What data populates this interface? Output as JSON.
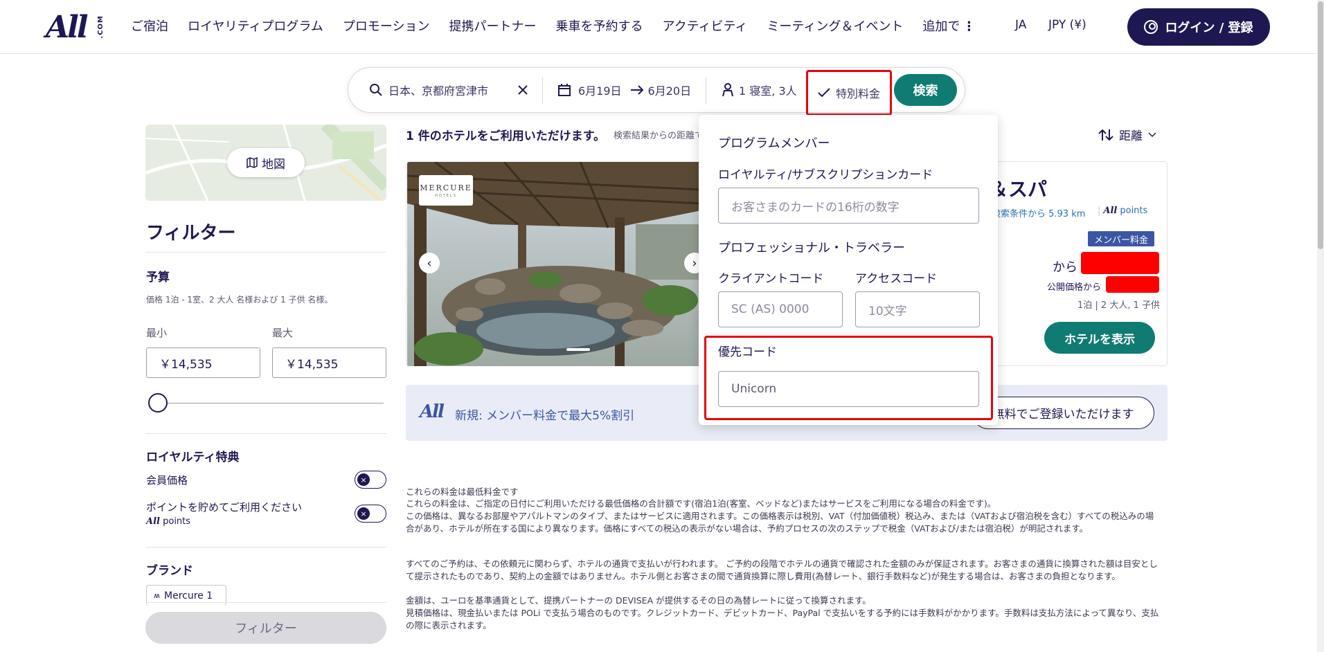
{
  "header": {
    "logo": "All",
    "logo_suffix": ".COM",
    "nav": [
      "ご宿泊",
      "ロイヤリティプログラム",
      "プロモーション",
      "提携パートナー",
      "乗車を予約する",
      "アクティビティ",
      "ミーティング＆イベント",
      "追加で"
    ],
    "language": "JA",
    "currency": "JPY (¥)",
    "login_label": "ログイン / 登録"
  },
  "search": {
    "destination": "日本、京都府宮津市",
    "checkin": "6月19日",
    "checkout": "6月20日",
    "guests": "1 寝室, 3人",
    "special_rate": "特別料金",
    "search_label": "検索"
  },
  "sidebar": {
    "map_label": "地図",
    "filter_title": "フィルター",
    "budget_title": "予算",
    "budget_sub": "価格 1泊 - 1室、2 大人 名様および 1 子供 名様。",
    "min_label": "最小",
    "max_label": "最大",
    "min_value": "￥14,535",
    "max_value": "￥14,535",
    "loyalty_title": "ロイヤルティ特典",
    "member_price_label": "会員価格",
    "points_label": "ポイントを貯めてご利用ください",
    "points_brand": "points",
    "brand_title": "ブランド",
    "brand_item": "Mercure 1",
    "filter_button": "フィルター"
  },
  "results": {
    "count": "1 件のホテルをご利用いただけます。",
    "count_sub": "検索結果からの距離で",
    "sort_label": "距離",
    "hotel": {
      "brand_logo": "MERCURE",
      "brand_logo_sub": "HOTELS",
      "name_tail": "＆スパ",
      "distance": "検索条件から 5.93 km",
      "points": "points",
      "member_badge": "メンバー料金",
      "from_label": "から",
      "public_label": "公開価格から",
      "stay_info": "1泊 | 2 大人, 1 子供",
      "view_button": "ホテルを表示"
    },
    "promo": {
      "text": "新規: メンバー料金で最大5%割引",
      "register_button": "無料でご登録いただけます"
    }
  },
  "dropdown": {
    "program_member_title": "プログラムメンバー",
    "loyalty_card_label": "ロイヤルティ/サブスクリプションカード",
    "loyalty_card_placeholder": "お客さまのカードの16桁の数字",
    "pro_traveler_title": "プロフェッショナル・トラベラー",
    "client_code_label": "クライアントコード",
    "client_code_placeholder": "SC (AS) 0000",
    "access_code_label": "アクセスコード",
    "access_code_placeholder": "10文字",
    "priority_code_label": "優先コード",
    "priority_code_value": "Unicorn"
  },
  "disclaimer": {
    "p1": "これらの料金は最低料金です",
    "p2": "これらの料金は、ご指定の日付にご利用いただける最低価格の合計額です(宿泊1泊(客室、ベッドなど)またはサービスをご利用になる場合の料金です)。",
    "p3": "この価格は、異なるお部屋やアパルトマンのタイプ、またはサービスに適用されます。この価格表示は税別、VAT（付加価値税）税込み、または（VATおよび宿泊税を含む）すべての税込みの場合があり、ホテルが所在する国により異なります。価格にすべての税込の表示がない場合は、予約プロセスの次のステップで税金（VATおよび/または宿泊税）が明記されます。",
    "p4": "すべてのご予約は、その依頼元に関わらず、ホテルの通貨で支払いが行われます。 ご予約の段階でホテルの通貨で確認された金額のみが保証されます。お客さまの通貨に換算された額は目安として提示されたものであり、契約上の金額ではありません。ホテル側とお客さまの間で通貨換算に際し費用(為替レート、銀行手数料など)が発生する場合は、お客さまの負担となります。",
    "p5": "金額は、ユーロを基準通貨として、提携パートナーの DEVISEA が提供するその日の為替レートに従って換算されます。",
    "p6": "見積価格は、現金払いまたは POLi で支払う場合のものです。クレジットカード、デビットカード、PayPal で支払いをする予約には手数料がかかります。手数料は支払方法によって異なり、支払の際に表示されます。"
  },
  "colors": {
    "navy": "#1e1852",
    "teal": "#0f7b73",
    "highlight_red": "#e8000b",
    "member_blue": "#3c55a5",
    "redaction": "#fd0000"
  }
}
